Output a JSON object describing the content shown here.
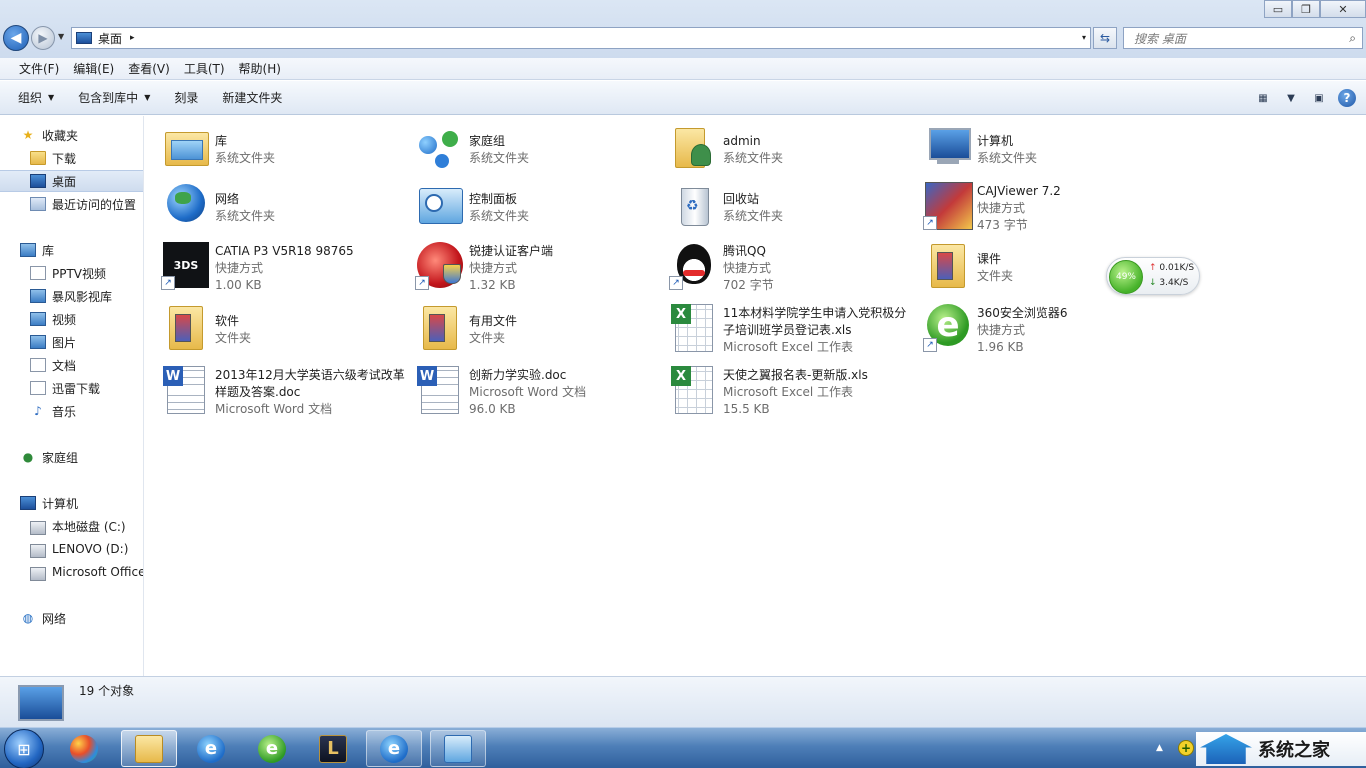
{
  "window": {
    "minimize": "▭",
    "maximize": "❐",
    "close": "✕"
  },
  "address": {
    "current": "桌面",
    "separator": "▸",
    "dropdown": "▾"
  },
  "search": {
    "placeholder": "搜索 桌面",
    "icon": "⌕"
  },
  "menubar": [
    "文件(F)",
    "编辑(E)",
    "查看(V)",
    "工具(T)",
    "帮助(H)"
  ],
  "commands": {
    "organize": "组织",
    "include_in_library": "包含到库中",
    "burn": "刻录",
    "new_folder": "新建文件夹"
  },
  "nav": {
    "favorites": "收藏夹",
    "downloads": "下载",
    "desktop": "桌面",
    "recent": "最近访问的位置",
    "libraries": "库",
    "pptv": "PPTV视频",
    "baofeng": "暴风影视库",
    "videos": "视频",
    "pictures": "图片",
    "documents": "文档",
    "thunder": "迅雷下载",
    "music": "音乐",
    "homegroup": "家庭组",
    "computer": "计算机",
    "drive_c": "本地磁盘 (C:)",
    "drive_d": "LENOVO (D:)",
    "drive_office": "Microsoft Office",
    "network": "网络"
  },
  "items": [
    {
      "name": "库",
      "line2": "系统文件夹"
    },
    {
      "name": "家庭组",
      "line2": "系统文件夹"
    },
    {
      "name": "admin",
      "line2": "系统文件夹"
    },
    {
      "name": "计算机",
      "line2": "系统文件夹"
    },
    {
      "name": "网络",
      "line2": "系统文件夹"
    },
    {
      "name": "控制面板",
      "line2": "系统文件夹"
    },
    {
      "name": "回收站",
      "line2": "系统文件夹"
    },
    {
      "name": "CAJViewer 7.2",
      "line2": "快捷方式",
      "line3": "473 字节"
    },
    {
      "name": "CATIA P3 V5R18 98765",
      "line2": "快捷方式",
      "line3": "1.00 KB"
    },
    {
      "name": "锐捷认证客户端",
      "line2": "快捷方式",
      "line3": "1.32 KB"
    },
    {
      "name": "腾讯QQ",
      "line2": "快捷方式",
      "line3": "702 字节"
    },
    {
      "name": "课件",
      "line2": "文件夹"
    },
    {
      "name": "软件",
      "line2": "文件夹"
    },
    {
      "name": "有用文件",
      "line2": "文件夹"
    },
    {
      "name": "11本材料学院学生申请入党积极分",
      "name2": "子培训班学员登记表.xls",
      "line2": "Microsoft Excel 工作表"
    },
    {
      "name": "360安全浏览器6",
      "line2": "快捷方式",
      "line3": "1.96 KB"
    },
    {
      "name": "2013年12月大学英语六级考试改革",
      "name2": "样题及答案.doc",
      "line2": "Microsoft Word 文档"
    },
    {
      "name": "创新力学实验.doc",
      "line2": "Microsoft Word 文档",
      "line3": "96.0 KB"
    },
    {
      "name": "天使之翼报名表-更新版.xls",
      "line2": "Microsoft Excel 工作表",
      "line3": "15.5 KB"
    }
  ],
  "netwidget": {
    "percent": "49%",
    "up": "0.01K/S",
    "down": "3.4K/S"
  },
  "status": {
    "count": "19 个对象"
  },
  "taskbar": {
    "start": "⊞",
    "ie_glyph": "e",
    "lol_glyph": "L"
  },
  "brand": {
    "text": "系统之家"
  }
}
